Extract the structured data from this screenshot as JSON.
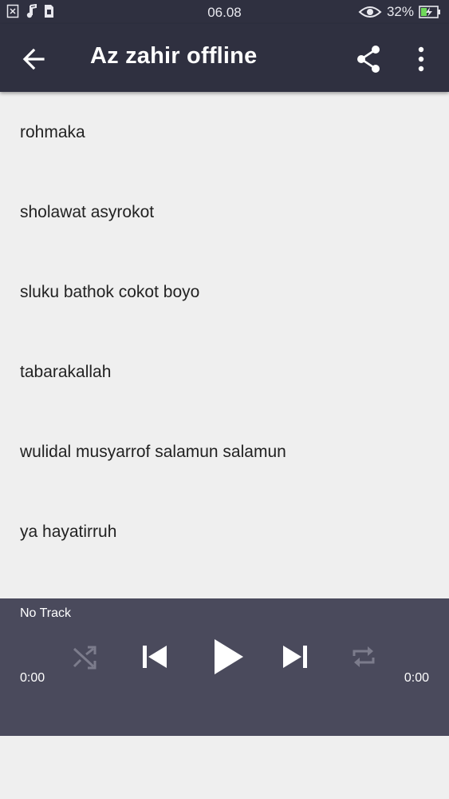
{
  "status_bar": {
    "time": "06.08",
    "battery_percent": "32%",
    "left_icons": [
      "close-box-icon",
      "music-note-icon",
      "sim-card-icon"
    ],
    "right_icons": [
      "eye-icon",
      "battery-charging-icon"
    ]
  },
  "app_bar": {
    "title": "Az zahir offline",
    "icons": [
      "back-arrow-icon",
      "share-icon",
      "more-vert-icon"
    ]
  },
  "list": {
    "items": [
      "rohmaka",
      "sholawat asyrokot",
      "sluku bathok cokot boyo",
      "tabarakallah",
      "wulidal musyarrof salamun salamun",
      "ya hayatirruh"
    ]
  },
  "player": {
    "track_label": "No Track",
    "time_elapsed": "0:00",
    "time_total": "0:00",
    "controls": [
      "shuffle-icon",
      "skip-previous-icon",
      "play-icon",
      "skip-next-icon",
      "repeat-icon"
    ]
  },
  "colors": {
    "app_bar_bg": "#2f3040",
    "player_bg": "#4a4a5c",
    "list_bg": "#efefef"
  }
}
